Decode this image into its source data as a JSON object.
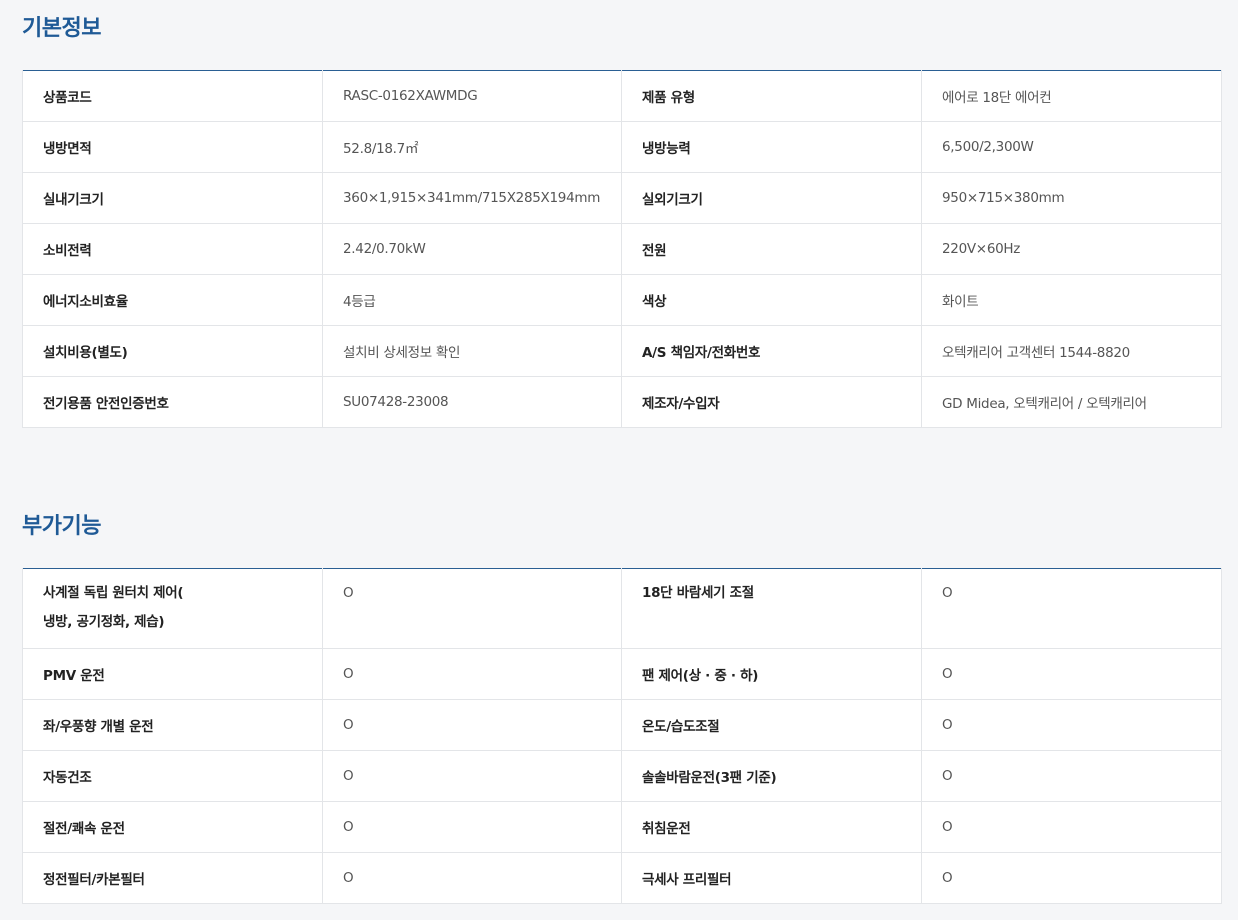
{
  "basic": {
    "title": "기본정보",
    "rows": [
      [
        {
          "label": "상품코드",
          "value": "RASC-0162XAWMDG"
        },
        {
          "label": "제품 유형",
          "value": "에어로 18단 에어컨"
        }
      ],
      [
        {
          "label": "냉방면적",
          "value": "52.8/18.7㎡"
        },
        {
          "label": "냉방능력",
          "value": "6,500/2,300W"
        }
      ],
      [
        {
          "label": "실내기크기",
          "value": "360×1,915×341mm/715X285X194mm"
        },
        {
          "label": "실외기크기",
          "value": "950×715×380mm"
        }
      ],
      [
        {
          "label": "소비전력",
          "value": "2.42/0.70kW"
        },
        {
          "label": "전원",
          "value": "220V×60Hz"
        }
      ],
      [
        {
          "label": "에너지소비효율",
          "value": "4등급"
        },
        {
          "label": "색상",
          "value": "화이트"
        }
      ],
      [
        {
          "label": "설치비용(별도)",
          "value": "설치비 상세정보 확인"
        },
        {
          "label": "A/S 책임자/전화번호",
          "value": "오텍캐리어 고객센터 1544-8820"
        }
      ],
      [
        {
          "label": "전기용품 안전인증번호",
          "value": "SU07428-23008"
        },
        {
          "label": "제조자/수입자",
          "value": "GD Midea, 오텍캐리어 / 오텍캐리어"
        }
      ]
    ]
  },
  "extra": {
    "title": "부가기능",
    "rows": [
      [
        {
          "label": "사계절 독립 원터치 제어(",
          "label2": "냉방, 공기정화, 제습)",
          "value": "O"
        },
        {
          "label": "18단 바람세기 조절",
          "value": "O"
        }
      ],
      [
        {
          "label": "PMV 운전",
          "value": "O"
        },
        {
          "label": "팬 제어(상 · 중 · 하)",
          "value": "O"
        }
      ],
      [
        {
          "label": "좌/우풍향 개별 운전",
          "value": "O"
        },
        {
          "label": "온도/습도조절",
          "value": "O"
        }
      ],
      [
        {
          "label": "자동건조",
          "value": "O"
        },
        {
          "label": "솔솔바람운전(3팬 기준)",
          "value": "O"
        }
      ],
      [
        {
          "label": "절전/쾌속 운전",
          "value": "O"
        },
        {
          "label": "취침운전",
          "value": "O"
        }
      ],
      [
        {
          "label": "정전필터/카본필터",
          "value": "O"
        },
        {
          "label": "극세사 프리필터",
          "value": "O"
        }
      ]
    ]
  }
}
